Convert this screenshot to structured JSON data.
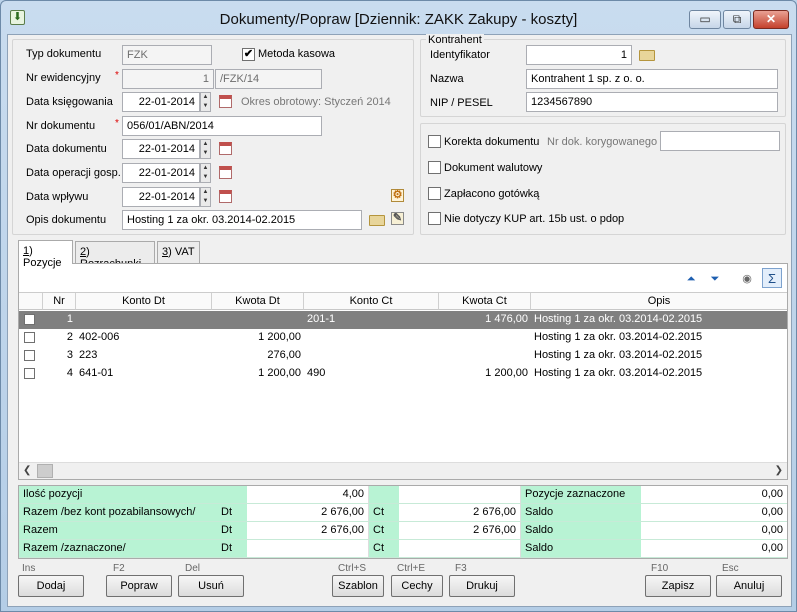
{
  "window": {
    "title": "Dokumenty/Popraw [Dziennik: ZAKK  Zakupy - koszty]",
    "minimize": "▭",
    "restore": "⧉",
    "close": "✕"
  },
  "form": {
    "typ_label": "Typ dokumentu",
    "typ_value": "FZK",
    "metoda_label": "Metoda kasowa",
    "metoda_checked": "✔",
    "nr_ew_label": "Nr ewidencyjny",
    "nr_ew_value": "1",
    "nr_ew_suffix": "/FZK/14",
    "data_ks_label": "Data księgowania",
    "data_ks_value": "22-01-2014",
    "okres_label": "Okres obrotowy: Styczeń 2014",
    "nr_dok_label": "Nr dokumentu",
    "nr_dok_value": "056/01/ABN/2014",
    "data_dok_label": "Data dokumentu",
    "data_dok_value": "22-01-2014",
    "data_op_label": "Data operacji gosp.",
    "data_op_value": "22-01-2014",
    "data_wp_label": "Data wpływu",
    "data_wp_value": "22-01-2014",
    "opis_label": "Opis dokumentu",
    "opis_value": "Hosting 1 za okr. 03.2014-02.2015",
    "required_mark": "*"
  },
  "kontrahent": {
    "group_label": "Kontrahent",
    "id_label": "Identyfikator",
    "id_value": "1",
    "nazwa_label": "Nazwa",
    "nazwa_value": "Kontrahent 1 sp. z o. o.",
    "nip_label": "NIP / PESEL",
    "nip_value": "1234567890"
  },
  "options": {
    "korekta_label": "Korekta dokumentu",
    "nr_kor_label": "Nr dok. korygowanego",
    "walutowy_label": "Dokument walutowy",
    "gotowka_label": "Zapłacono gotówką",
    "kup_label": "Nie dotyczy KUP art. 15b ust. o pdop"
  },
  "tabs": [
    {
      "key": "1",
      "label": ") Pozycje"
    },
    {
      "key": "2",
      "label": ") Rozrachunki"
    },
    {
      "key": "3",
      "label": ") VAT"
    }
  ],
  "grid": {
    "columns": [
      "Nr",
      "Konto Dt",
      "Kwota Dt",
      "Konto Ct",
      "Kwota Ct",
      "Opis"
    ],
    "rows": [
      {
        "nr": "1",
        "konto_dt": "",
        "kwota_dt": "",
        "konto_ct": "201-1",
        "kwota_ct": "1 476,00",
        "opis": "Hosting 1 za okr. 03.2014-02.2015"
      },
      {
        "nr": "2",
        "konto_dt": "402-006",
        "kwota_dt": "1 200,00",
        "konto_ct": "",
        "kwota_ct": "",
        "opis": "Hosting 1 za okr. 03.2014-02.2015"
      },
      {
        "nr": "3",
        "konto_dt": "223",
        "kwota_dt": "276,00",
        "konto_ct": "",
        "kwota_ct": "",
        "opis": "Hosting 1 za okr. 03.2014-02.2015"
      },
      {
        "nr": "4",
        "konto_dt": "641-01",
        "kwota_dt": "1 200,00",
        "konto_ct": "490",
        "kwota_ct": "1 200,00",
        "opis": "Hosting 1 za okr. 03.2014-02.2015"
      }
    ]
  },
  "summary": {
    "ilosc_label": "Ilość pozycji",
    "ilosc_value": "4,00",
    "razem_bez_label": "Razem /bez kont pozabilansowych/",
    "razem_bez_dt": "Dt",
    "razem_bez_dt_value": "2 676,00",
    "razem_bez_ct": "Ct",
    "razem_bez_ct_value": "2 676,00",
    "razem_label": "Razem",
    "razem_dt": "Dt",
    "razem_dt_value": "2 676,00",
    "razem_ct": "Ct",
    "razem_ct_value": "2 676,00",
    "razem_zazn_label": "Razem /zaznaczone/",
    "razem_zazn_dt": "Dt",
    "razem_zazn_ct": "Ct",
    "poz_zazn_label": "Pozycje zaznaczone",
    "poz_zazn_value": "0,00",
    "saldo1_label": "Saldo",
    "saldo1_value": "0,00",
    "saldo2_label": "Saldo",
    "saldo2_value": "0,00",
    "saldo3_label": "Saldo",
    "saldo3_value": "0,00"
  },
  "buttons": {
    "dodaj": "Dodaj",
    "dodaj_key": "Ins",
    "popraw": "Popraw",
    "popraw_key": "F2",
    "usun": "Usuń",
    "usun_key": "Del",
    "szablon": "Szablon",
    "szablon_key": "Ctrl+S",
    "cechy": "Cechy",
    "cechy_key": "Ctrl+E",
    "drukuj": "Drukuj",
    "drukuj_key": "F3",
    "zapisz": "Zapisz",
    "zapisz_key": "F10",
    "anuluj": "Anuluj",
    "anuluj_key": "Esc"
  },
  "toolbar": {
    "move_up": "⏶",
    "move_down": "⏷",
    "sum": "Σ"
  },
  "colors": {
    "summary_green": "#b8f3d4",
    "selected_row": "#808080",
    "required": "#dd0000"
  }
}
